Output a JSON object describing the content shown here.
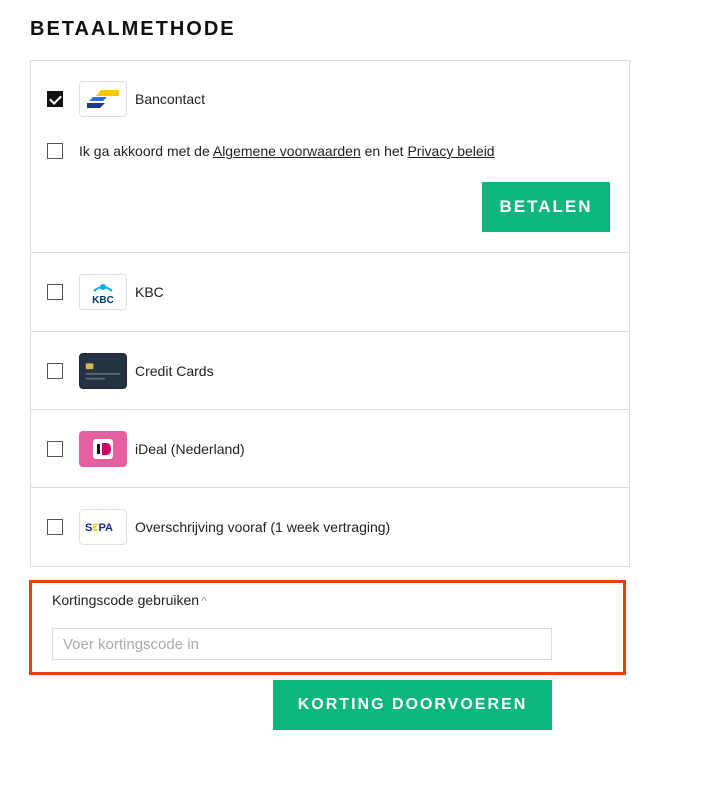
{
  "section_title": "BETAALMETHODE",
  "methods": [
    {
      "label": "Bancontact",
      "checked": true,
      "logo": "bancontact-logo"
    },
    {
      "label": "KBC",
      "checked": false,
      "logo": "kbc-logo"
    },
    {
      "label": "Credit Cards",
      "checked": false,
      "logo": "credit-card-logo"
    },
    {
      "label": "iDeal (Nederland)",
      "checked": false,
      "logo": "ideal-logo"
    },
    {
      "label": "Overschrijving vooraf (1 week vertraging)",
      "checked": false,
      "logo": "sepa-logo"
    }
  ],
  "logo_texts": {
    "kbc": "KBC",
    "sepa_s": "S",
    "sepa_rest": "PA"
  },
  "terms": {
    "prefix": "Ik ga akkoord met de ",
    "link1": "Algemene voorwaarden",
    "middle": " en het ",
    "link2": "Privacy beleid"
  },
  "pay_button": "BETALEN",
  "discount": {
    "toggle_label": "Kortingscode gebruiken",
    "chevron": "^",
    "placeholder": "Voer kortingscode in",
    "apply_button": "KORTING DOORVOEREN"
  },
  "colors": {
    "accent_green": "#0db77c",
    "highlight_border": "#e8400c"
  }
}
